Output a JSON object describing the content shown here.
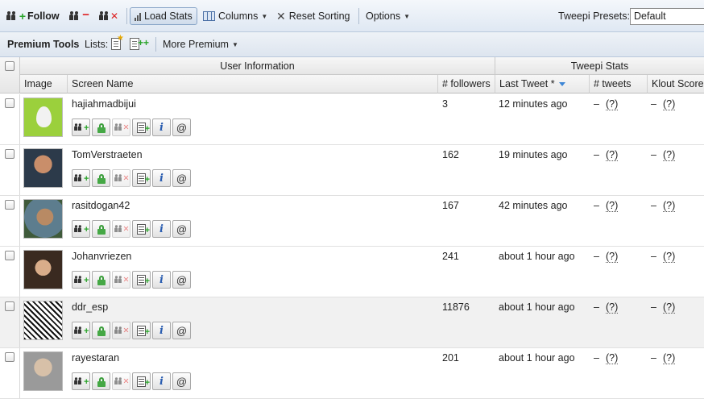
{
  "toolbar": {
    "follow_label": "Follow",
    "load_stats_label": "Load Stats",
    "columns_label": "Columns",
    "reset_sorting_label": "Reset Sorting",
    "options_label": "Options",
    "presets_label": "Tweepi Presets:",
    "presets_value": "Default"
  },
  "premium": {
    "title": "Premium Tools",
    "lists_label": "Lists:",
    "more_label": "More Premium"
  },
  "grid": {
    "group_user": "User Information",
    "group_stats": "Tweepi Stats",
    "columns": {
      "image": "Image",
      "screen_name": "Screen Name",
      "followers": "# followers",
      "last_tweet": "Last Tweet *",
      "tweets": "# tweets",
      "klout": "Klout Score"
    },
    "placeholder_dash": "–",
    "placeholder_q": "(?)",
    "rows": [
      {
        "name": "hajiahmadbijui",
        "followers": "3",
        "last_tweet": "12 minutes ago"
      },
      {
        "name": "TomVerstraeten",
        "followers": "162",
        "last_tweet": "19 minutes ago"
      },
      {
        "name": "rasitdogan42",
        "followers": "167",
        "last_tweet": "42 minutes ago"
      },
      {
        "name": "Johanvriezen",
        "followers": "241",
        "last_tweet": "about 1 hour ago"
      },
      {
        "name": "ddr_esp",
        "followers": "11876",
        "last_tweet": "about 1 hour ago"
      },
      {
        "name": "rayestaran",
        "followers": "201",
        "last_tweet": "about 1 hour ago"
      }
    ]
  }
}
